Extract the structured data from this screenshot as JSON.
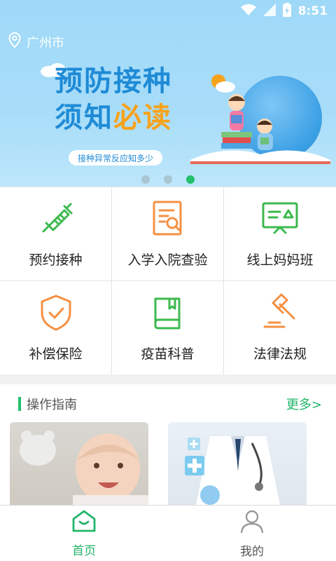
{
  "status_bar": {
    "time": "8:51"
  },
  "header": {
    "location": "广州市"
  },
  "banner": {
    "title_line1": "预防接种",
    "title_line2_part1": "须知",
    "title_line2_part2": "必读",
    "subtitle": "接种异常反应知多少",
    "active_dot": 3
  },
  "grid": {
    "items": [
      {
        "label": "预约接种",
        "icon": "syringe-icon",
        "color": "#3cb94e"
      },
      {
        "label": "入学入院查验",
        "icon": "document-search-icon",
        "color": "#f59042"
      },
      {
        "label": "线上妈妈班",
        "icon": "presentation-board-icon",
        "color": "#3cb94e"
      },
      {
        "label": "补偿保险",
        "icon": "shield-check-icon",
        "color": "#f59042"
      },
      {
        "label": "疫苗科普",
        "icon": "book-icon",
        "color": "#3cb94e"
      },
      {
        "label": "法律法规",
        "icon": "gavel-icon",
        "color": "#f59042"
      }
    ]
  },
  "guide": {
    "title": "操作指南",
    "more": "更多>"
  },
  "bottom_nav": {
    "home": "首页",
    "mine": "我的"
  },
  "colors": {
    "accent_green": "#22c06d",
    "accent_orange": "#f59042",
    "banner_blue": "#1f8bd6"
  }
}
